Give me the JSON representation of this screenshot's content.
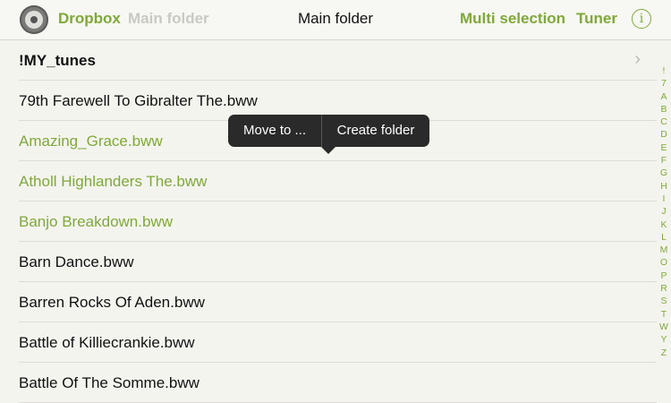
{
  "navbar": {
    "app_icon": "film-reel-icon",
    "back_link": "Dropbox",
    "parent_link": "Main folder",
    "title": "Main folder",
    "multi_selection": "Multi selection",
    "tuner": "Tuner",
    "info_symbol": "i"
  },
  "colors": {
    "accent": "#7fa83a",
    "text": "#111111",
    "popover": "#2a2a2a"
  },
  "files": [
    {
      "name": "!MY_tunes"
    },
    {
      "name": "79th Farewell To Gibralter The.bww"
    },
    {
      "name": "Amazing_Grace.bww"
    },
    {
      "name": "Atholl Highlanders The.bww"
    },
    {
      "name": "Banjo Breakdown.bww"
    },
    {
      "name": "Barn Dance.bww"
    },
    {
      "name": "Barren Rocks Of Aden.bww"
    },
    {
      "name": "Battle of Killiecrankie.bww"
    },
    {
      "name": "Battle Of The Somme.bww"
    }
  ],
  "popover": {
    "move_label": "Move to ...",
    "create_label": "Create folder"
  },
  "index": [
    "!",
    "7",
    "A",
    "B",
    "C",
    "D",
    "E",
    "F",
    "G",
    "H",
    "I",
    "J",
    "K",
    "L",
    "M",
    "O",
    "P",
    "R",
    "S",
    "T",
    "W",
    "Y",
    "Z"
  ]
}
